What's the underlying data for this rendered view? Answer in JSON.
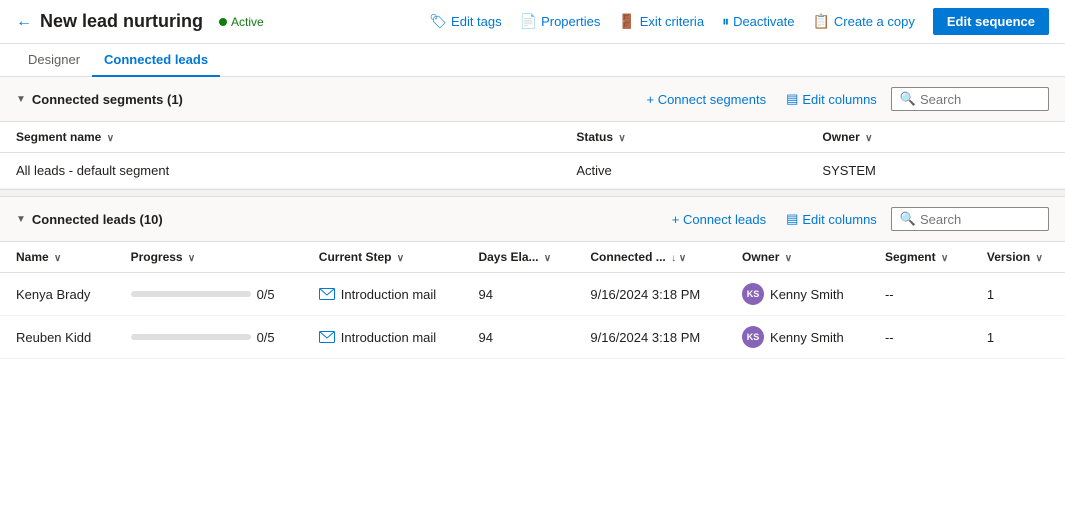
{
  "header": {
    "back_label": "←",
    "title": "New lead nurturing",
    "status": "Active",
    "actions": [
      {
        "id": "edit-tags",
        "icon": "🏷",
        "label": "Edit tags"
      },
      {
        "id": "properties",
        "icon": "📄",
        "label": "Properties"
      },
      {
        "id": "exit-criteria",
        "icon": "🚪",
        "label": "Exit criteria"
      },
      {
        "id": "deactivate",
        "icon": "⏸",
        "label": "Deactivate"
      },
      {
        "id": "create-copy",
        "icon": "📋",
        "label": "Create a copy"
      }
    ],
    "edit_sequence_label": "Edit sequence"
  },
  "tabs": [
    {
      "id": "designer",
      "label": "Designer"
    },
    {
      "id": "connected-leads",
      "label": "Connected leads",
      "active": true
    }
  ],
  "segments_section": {
    "title": "Connected segments",
    "count": 1,
    "connect_label": "+ Connect segments",
    "edit_columns_label": "Edit columns",
    "search_placeholder": "Search",
    "columns": [
      {
        "id": "segment-name",
        "label": "Segment name",
        "sortable": true
      },
      {
        "id": "status",
        "label": "Status",
        "sortable": true
      },
      {
        "id": "owner",
        "label": "Owner",
        "sortable": true
      }
    ],
    "rows": [
      {
        "segment_name": "All leads - default segment",
        "status": "Active",
        "owner": "SYSTEM"
      }
    ]
  },
  "leads_section": {
    "title": "Connected leads",
    "count": 10,
    "connect_label": "+ Connect leads",
    "edit_columns_label": "Edit columns",
    "search_placeholder": "Search",
    "columns": [
      {
        "id": "name",
        "label": "Name",
        "sortable": true
      },
      {
        "id": "progress",
        "label": "Progress",
        "sortable": true
      },
      {
        "id": "current-step",
        "label": "Current Step",
        "sortable": true
      },
      {
        "id": "days-elapsed",
        "label": "Days Ela...",
        "sortable": true
      },
      {
        "id": "connected",
        "label": "Connected ...",
        "sortable": true
      },
      {
        "id": "owner",
        "label": "Owner",
        "sortable": true
      },
      {
        "id": "segment",
        "label": "Segment",
        "sortable": true
      },
      {
        "id": "version",
        "label": "Version",
        "sortable": true
      }
    ],
    "rows": [
      {
        "name": "Kenya Brady",
        "progress_value": 0,
        "progress_max": 5,
        "progress_label": "0/5",
        "current_step": "Introduction mail",
        "days_elapsed": "94",
        "connected_date": "9/16/2024 3:18 PM",
        "owner_initials": "KS",
        "owner_name": "Kenny Smith",
        "segment": "--",
        "version": "1"
      },
      {
        "name": "Reuben Kidd",
        "progress_value": 0,
        "progress_max": 5,
        "progress_label": "0/5",
        "current_step": "Introduction mail",
        "days_elapsed": "94",
        "connected_date": "9/16/2024 3:18 PM",
        "owner_initials": "KS",
        "owner_name": "Kenny Smith",
        "segment": "--",
        "version": "1"
      }
    ]
  }
}
